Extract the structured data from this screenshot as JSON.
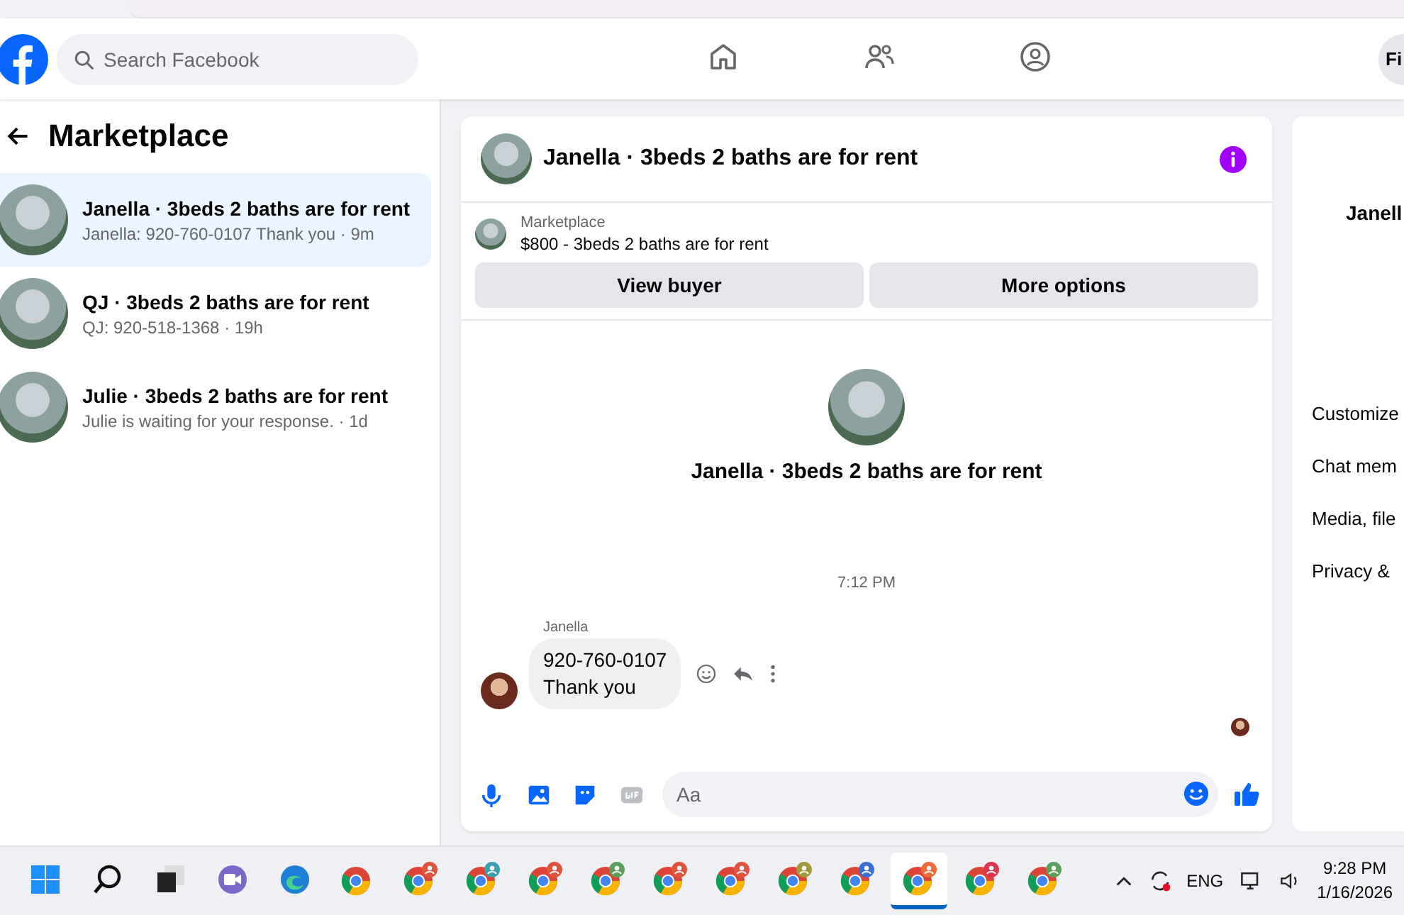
{
  "header": {
    "search": {
      "placeholder": "Search Facebook"
    },
    "nav": [
      {
        "kind": "home",
        "selected": false
      },
      {
        "kind": "friends",
        "selected": false
      },
      {
        "kind": "groups",
        "selected": false
      }
    ],
    "profile_button": "Fi"
  },
  "sidebar": {
    "title": "Marketplace",
    "conversations": [
      {
        "title": "Janella · 3beds 2 baths are for rent",
        "preview": "Janella: 920-760-0107 Thank you · 9m",
        "selected": true
      },
      {
        "title": "QJ · 3beds 2 baths are for rent",
        "preview": "QJ: 920-518-1368 · 19h",
        "selected": false
      },
      {
        "title": "Julie · 3beds 2 baths are for rent",
        "preview": "Julie is waiting for your response. · 1d",
        "selected": false
      }
    ]
  },
  "chat": {
    "title": "Janella · 3beds 2 baths are for rent",
    "listing": {
      "source": "Marketplace",
      "item": "$800 - 3beds 2 baths are for rent"
    },
    "buttons": [
      "View buyer",
      "More options"
    ],
    "intro_title": "Janella · 3beds 2 baths are for rent",
    "timestamp": "7:12 PM",
    "messages": [
      {
        "sender": "Janella",
        "lines": [
          "920-760-0107",
          "Thank you"
        ]
      }
    ],
    "composer": {
      "placeholder": "Aa"
    }
  },
  "details": {
    "name": "Janell",
    "items": [
      "Customize",
      "Chat mem",
      "Media, file",
      "Privacy &"
    ]
  },
  "taskbar": {
    "apps": [
      {
        "kind": "windows",
        "selected": false
      },
      {
        "kind": "search",
        "selected": false
      },
      {
        "kind": "taskview",
        "selected": false
      },
      {
        "kind": "meet",
        "selected": false
      },
      {
        "kind": "edge",
        "selected": false
      },
      {
        "kind": "chrome",
        "selected": false
      },
      {
        "kind": "chrome-profile",
        "color": "#e0533f",
        "selected": false
      },
      {
        "kind": "chrome-profile",
        "color": "#3a9fb0",
        "selected": false
      },
      {
        "kind": "chrome-profile",
        "color": "#e0533f",
        "selected": false
      },
      {
        "kind": "chrome-profile",
        "color": "#5ba05a",
        "selected": false
      },
      {
        "kind": "chrome-profile",
        "color": "#e0533f",
        "selected": false
      },
      {
        "kind": "chrome-profile",
        "color": "#e0533f",
        "selected": false
      },
      {
        "kind": "chrome-profile",
        "color": "#a09a3c",
        "selected": false
      },
      {
        "kind": "chrome-profile",
        "color": "#3b6fd6",
        "selected": false
      },
      {
        "kind": "chrome-profile",
        "color": "#f06a3a",
        "selected": true
      },
      {
        "kind": "chrome-profile",
        "color": "#e0334f",
        "selected": false
      },
      {
        "kind": "chrome-profile",
        "color": "#5ba05a",
        "selected": false
      }
    ],
    "language": "ENG",
    "time": "9:28 PM",
    "date": "1/16/2026"
  }
}
